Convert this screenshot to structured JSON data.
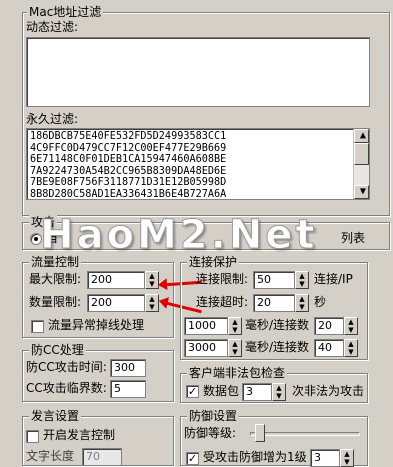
{
  "mac_filter": {
    "title": "Mac地址过滤",
    "dynamic_label": "动态过滤:",
    "permanent_label": "永久过滤:",
    "permanent_list": [
      "186DBCB75E40FE532FD5D24993583CC1",
      "4C9FFC0D479CC7F12C00EF477E29B669",
      "6E71148C0F01DEB1CA15947460A608BE",
      "7A9224730A54B2CC965B8309DA48ED6E",
      "7BE9E08F756F3118771D31E12B05998D",
      "8B8D280C58AD1EA336431B6E4B727A6A"
    ]
  },
  "attack": {
    "title": "攻击",
    "option1": "自",
    "option2": "列表"
  },
  "watermark": "HaoM2.Net",
  "flow_control": {
    "title": "流量控制",
    "max_label": "最大限制:",
    "max_value": "200",
    "count_label": "数量限制:",
    "count_value": "200",
    "abnormal_label": "流量异常掉线处理",
    "abnormal_checked": false
  },
  "conn_protect": {
    "title": "连接保护",
    "limit_label": "连接限制:",
    "limit_value": "50",
    "limit_unit": "连接/IP",
    "timeout_label": "连接超时:",
    "timeout_value": "20",
    "timeout_unit": "秒",
    "rule1_ms": "1000",
    "rule1_label": "毫秒/连接数",
    "rule1_count": "20",
    "rule2_ms": "3000",
    "rule2_label": "毫秒/连接数",
    "rule2_count": "40"
  },
  "anti_cc": {
    "title": "防CC处理",
    "time_label": "防CC攻击时间:",
    "time_value": "300",
    "threshold_label": "CC攻击临界数:",
    "threshold_value": "5"
  },
  "client_check": {
    "title": "客户端非法包检查",
    "packet_label": "数据包",
    "packet_checked": true,
    "packet_value": "3",
    "packet_suffix": "次非法为攻击"
  },
  "speech": {
    "title": "发言设置",
    "enable_label": "开启发言控制",
    "enable_checked": false,
    "length_label": "文字长度",
    "length_value": "70"
  },
  "defense": {
    "title": "防御设置",
    "level_label": "防御等级:",
    "level": 0.05,
    "attack_label": "受攻击防御增为1级",
    "attack_checked": true,
    "attack_value": "3"
  }
}
